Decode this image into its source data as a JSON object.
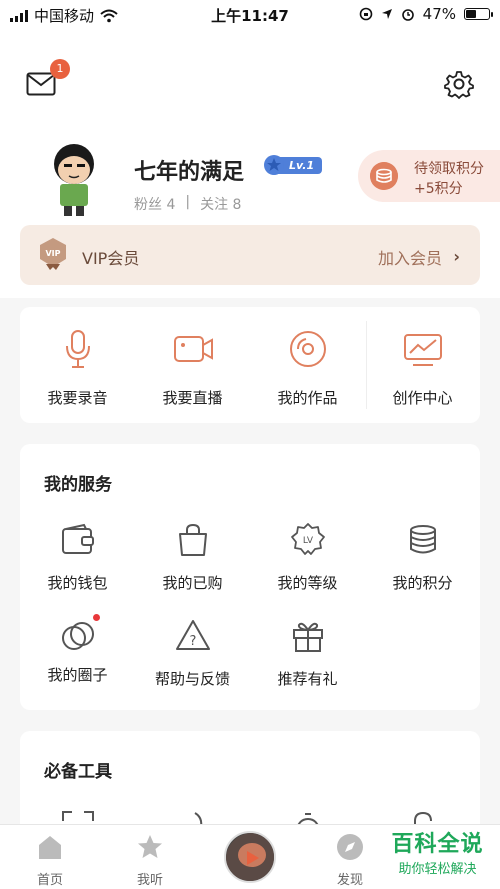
{
  "status_bar": {
    "carrier": "中国移动",
    "time": "上午11:47",
    "battery": "47%",
    "battery_level": 0.47
  },
  "header": {
    "mail_badge": "1"
  },
  "profile": {
    "nickname": "七年的满足",
    "level": "Lv.1",
    "fans_label": "粉丝 4",
    "follow_label": "关注 8",
    "separator": "|"
  },
  "points": {
    "line1": "待领取积分",
    "line2": "+5积分"
  },
  "vip": {
    "label": "VIP会员",
    "action": "加入会员",
    "chevron": "›"
  },
  "quick_actions": [
    {
      "label": "我要录音",
      "icon": "microphone-icon"
    },
    {
      "label": "我要直播",
      "icon": "video-camera-icon"
    },
    {
      "label": "我的作品",
      "icon": "disc-icon"
    },
    {
      "label": "创作中心",
      "icon": "chart-monitor-icon"
    }
  ],
  "services": {
    "title": "我的服务",
    "items": [
      {
        "label": "我的钱包",
        "icon": "wallet-icon"
      },
      {
        "label": "我的已购",
        "icon": "shopping-bag-icon"
      },
      {
        "label": "我的等级",
        "icon": "level-badge-icon"
      },
      {
        "label": "我的积分",
        "icon": "coins-stack-icon"
      },
      {
        "label": "我的圈子",
        "icon": "circles-icon",
        "has_dot": true
      },
      {
        "label": "帮助与反馈",
        "icon": "warning-help-icon"
      },
      {
        "label": "推荐有礼",
        "icon": "gift-icon"
      }
    ]
  },
  "tools": {
    "title": "必备工具"
  },
  "tabbar": {
    "items": [
      {
        "label": "首页",
        "icon": "home-icon"
      },
      {
        "label": "我听",
        "icon": "star-icon"
      },
      {
        "label": "发现",
        "icon": "compass-icon"
      }
    ]
  },
  "watermark": {
    "title": "百科全说",
    "subtitle": "助你轻松解决"
  },
  "colors": {
    "accent": "#e0805f",
    "badge": "#e8613f",
    "level_blue": "#4f7fd9",
    "watermark_green": "#1fa85a"
  }
}
